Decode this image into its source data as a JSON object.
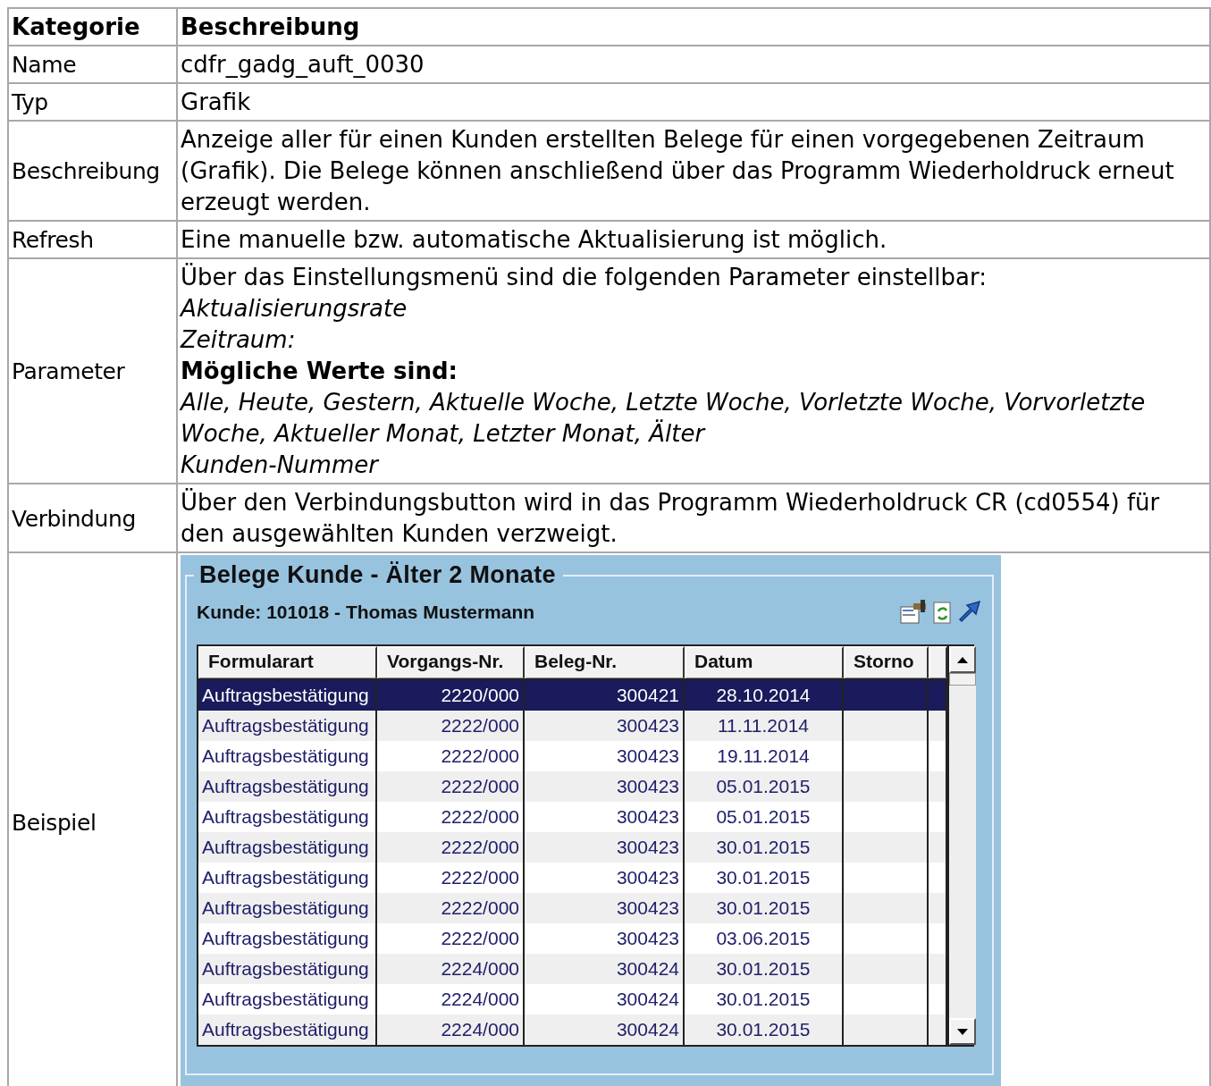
{
  "table": {
    "columns": [
      "Kategorie",
      "Beschreibung"
    ],
    "rows": [
      {
        "kind": "text",
        "label": "Name",
        "value": "cdfr_gadg_auft_0030"
      },
      {
        "kind": "text",
        "label": "Typ",
        "value": "Grafik"
      },
      {
        "kind": "text",
        "label": "Beschreibung",
        "value": "Anzeige aller für einen Kunden erstellten Belege für einen vorgegebenen Zeitraum (Grafik). Die Belege können anschließend über das Programm Wiederholdruck erneut erzeugt werden."
      },
      {
        "kind": "text",
        "label": "Refresh",
        "value": "Eine manuelle bzw. automatische Aktualisierung ist möglich."
      },
      {
        "kind": "lines",
        "label": "Parameter",
        "lines": [
          {
            "kind": "intro",
            "text": "Über das Einstellungsmenü sind die folgenden Parameter einstellbar:"
          },
          {
            "kind": "parameter",
            "text": "Aktualisierungsrate"
          },
          {
            "kind": "parameter",
            "text": "Zeitraum:"
          },
          {
            "kind": "heading",
            "text": "Mögliche Werte sind:"
          },
          {
            "kind": "parameter",
            "text": "Alle, Heute, Gestern, Aktuelle Woche, Letzte Woche, Vorletzte Woche, Vorvorletzte Woche, Aktueller Monat, Letzter Monat, Älter"
          },
          {
            "kind": "parameter",
            "text": "Kunden-Nummer"
          }
        ]
      },
      {
        "kind": "text",
        "label": "Verbindung",
        "value": "Über den Verbindungsbutton wird in das Programm Wiederholdruck CR (cd0554) für den ausgewählten Kunden verzweigt."
      },
      {
        "kind": "widget",
        "label": "Beispiel",
        "widget": {
          "title": "Belege Kunde - Älter 2 Monate",
          "subtitle": "Kunde: 101018 - Thomas Mustermann",
          "grid_headers": [
            "Formularart",
            "Vorgangs-Nr.",
            "Beleg-Nr.",
            "Datum",
            "Storno"
          ],
          "entries": [
            {
              "selected": true,
              "cells": [
                "Auftragsbestätigung",
                "2220/000",
                "300421",
                "28.10.2014"
              ]
            },
            {
              "selected": false,
              "cells": [
                "Auftragsbestätigung",
                "2222/000",
                "300423",
                "11.11.2014"
              ]
            },
            {
              "selected": false,
              "cells": [
                "Auftragsbestätigung",
                "2222/000",
                "300423",
                "19.11.2014"
              ]
            },
            {
              "selected": false,
              "cells": [
                "Auftragsbestätigung",
                "2222/000",
                "300423",
                "05.01.2015"
              ]
            },
            {
              "selected": false,
              "cells": [
                "Auftragsbestätigung",
                "2222/000",
                "300423",
                "05.01.2015"
              ]
            },
            {
              "selected": false,
              "cells": [
                "Auftragsbestätigung",
                "2222/000",
                "300423",
                "30.01.2015"
              ]
            },
            {
              "selected": false,
              "cells": [
                "Auftragsbestätigung",
                "2222/000",
                "300423",
                "30.01.2015"
              ]
            },
            {
              "selected": false,
              "cells": [
                "Auftragsbestätigung",
                "2222/000",
                "300423",
                "30.01.2015"
              ]
            },
            {
              "selected": false,
              "cells": [
                "Auftragsbestätigung",
                "2222/000",
                "300423",
                "03.06.2015"
              ]
            },
            {
              "selected": false,
              "cells": [
                "Auftragsbestätigung",
                "2224/000",
                "300424",
                "30.01.2015"
              ]
            },
            {
              "selected": false,
              "cells": [
                "Auftragsbestätigung",
                "2224/000",
                "300424",
                "30.01.2015"
              ]
            },
            {
              "selected": false,
              "cells": [
                "Auftragsbestätigung",
                "2224/000",
                "300424",
                "30.01.2015"
              ]
            }
          ]
        }
      }
    ]
  }
}
